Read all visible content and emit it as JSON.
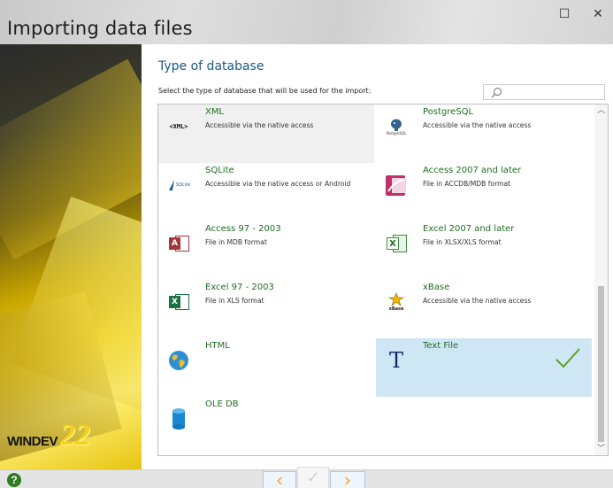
{
  "window": {
    "title": "Importing data files",
    "controls": {
      "maximize": "☐",
      "close": "✕"
    }
  },
  "brand": {
    "logo_text": "WINDEV",
    "logo_version": "22"
  },
  "page": {
    "heading": "Type of database",
    "subtitle": "Select the type of database that will be used for the import:",
    "search": {
      "value": "",
      "placeholder": ""
    }
  },
  "databases": [
    {
      "name": "XML",
      "desc": "Accessible via the native access",
      "icon": "xml-icon",
      "icon_text": "<XML>",
      "state": "hover"
    },
    {
      "name": "PostgreSQL",
      "desc": "Accessible via the native access",
      "icon": "postgresql-icon",
      "icon_text": "PostgreSQL"
    },
    {
      "name": "SQLite",
      "desc": "Accessible via the native access or Android",
      "icon": "sqlite-icon",
      "icon_text": "SQLite"
    },
    {
      "name": "Access 2007 and later",
      "desc": "File in ACCDB/MDB format",
      "icon": "access-2007-icon"
    },
    {
      "name": "Access 97 - 2003",
      "desc": "File in MDB format",
      "icon": "access-97-icon",
      "icon_text": "A"
    },
    {
      "name": "Excel 2007 and later",
      "desc": "File in XLSX/XLS format",
      "icon": "excel-2007-icon",
      "icon_text": "X"
    },
    {
      "name": "Excel 97 - 2003",
      "desc": "File in XLS format",
      "icon": "excel-97-icon",
      "icon_text": "X"
    },
    {
      "name": "xBase",
      "desc": "Accessible via the native access",
      "icon": "xbase-icon",
      "icon_text": "xBase"
    },
    {
      "name": "HTML",
      "desc": "",
      "icon": "globe-icon"
    },
    {
      "name": "Text File",
      "desc": "",
      "icon": "text-file-icon",
      "icon_text": "T",
      "state": "selected"
    },
    {
      "name": "OLE DB",
      "desc": "",
      "icon": "database-cylinder-icon"
    }
  ],
  "nav": {
    "back": "‹",
    "finish": "✓",
    "next": "›",
    "help": "?"
  },
  "colors": {
    "item_name": "#1f6e1f",
    "heading": "#1b5a84",
    "selected_bg": "#cfe6f4",
    "check": "#5aa32a"
  }
}
